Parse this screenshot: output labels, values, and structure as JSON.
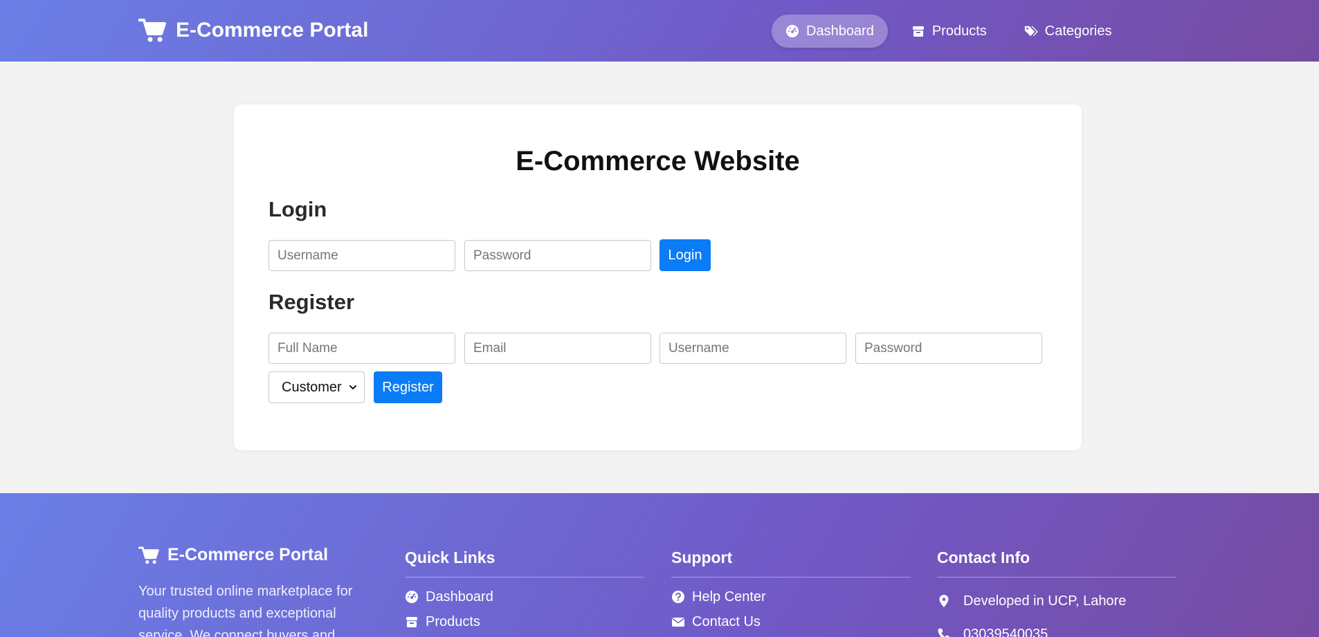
{
  "nav": {
    "brand": "E-Commerce Portal",
    "links": [
      {
        "label": "Dashboard",
        "icon": "dashboard-icon"
      },
      {
        "label": "Products",
        "icon": "box-icon"
      },
      {
        "label": "Categories",
        "icon": "tags-icon"
      }
    ],
    "active": "Dashboard"
  },
  "card": {
    "title": "E-Commerce Website",
    "login": {
      "heading": "Login",
      "username_placeholder": "Username",
      "password_placeholder": "Password",
      "button": "Login"
    },
    "register": {
      "heading": "Register",
      "fullname_placeholder": "Full Name",
      "email_placeholder": "Email",
      "username_placeholder": "Username",
      "password_placeholder": "Password",
      "role_selected": "Customer",
      "button": "Register"
    }
  },
  "footer": {
    "brand": "E-Commerce Portal",
    "description": "Your trusted online marketplace for quality products and exceptional service. We connect buyers and",
    "quick_links": {
      "heading": "Quick Links",
      "items": [
        {
          "label": "Dashboard",
          "icon": "dashboard-icon"
        },
        {
          "label": "Products",
          "icon": "box-icon"
        }
      ]
    },
    "support": {
      "heading": "Support",
      "items": [
        {
          "label": "Help Center",
          "icon": "question-circle-icon"
        },
        {
          "label": "Contact Us",
          "icon": "envelope-icon"
        }
      ]
    },
    "contact": {
      "heading": "Contact Info",
      "items": [
        {
          "label": "Developed in UCP, Lahore",
          "icon": "map-pin-icon"
        },
        {
          "label": "03039540035",
          "icon": "phone-icon"
        }
      ]
    }
  },
  "colors": {
    "accent": "#0a7cf5",
    "gradient_start": "#6a7fe6",
    "gradient_end": "#764ba2",
    "page_bg": "#f3f3f3"
  }
}
